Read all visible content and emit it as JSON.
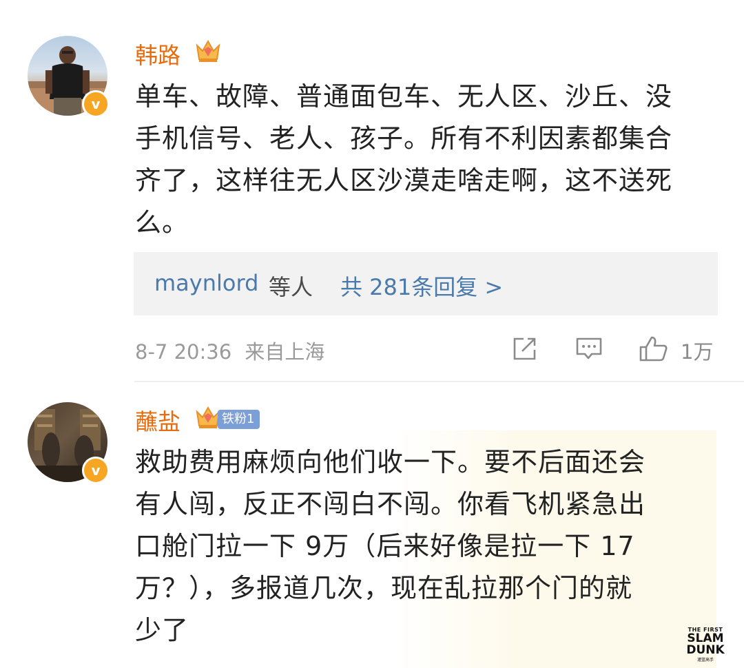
{
  "comments": [
    {
      "user": "韩路",
      "text": "单车、故障、普通面包车、无人区、沙丘、没\n手机信号、老人、孩子。所有不利因素都集合\n齐了，这样往无人区沙漠走啥走啊，这不送死\n么。",
      "replies": {
        "user": "maynlord",
        "rest": "等人",
        "count": "共 281条回复 >"
      },
      "time": "8-7 20:36",
      "location": "来自上海",
      "likes": "1万",
      "icons": [
        "verified-icon",
        "crown-icon",
        "share-icon",
        "comment-icon",
        "like-icon"
      ]
    },
    {
      "user": "蘸盐",
      "fan_badge": "铁粉1",
      "text": "救助费用麻烦向他们收一下。要不后面还会\n有人闯，反正不闯白不闯。你看飞机紧急出\n口舱门拉一下 9万（后来好像是拉一下 17\n万？），多报道几次，现在乱拉那个门的就\n少了",
      "icons": [
        "verified-icon",
        "crown-icon"
      ]
    }
  ],
  "watermark": {
    "line1": "THE FIRST",
    "line2a": "SLAM",
    "line2b": "DUNK",
    "line3": "灌篮高手"
  },
  "colors": {
    "username": "#e86b0c",
    "link": "#4a79ac",
    "meta": "#9a9a9a",
    "verified": "#f6a623"
  }
}
